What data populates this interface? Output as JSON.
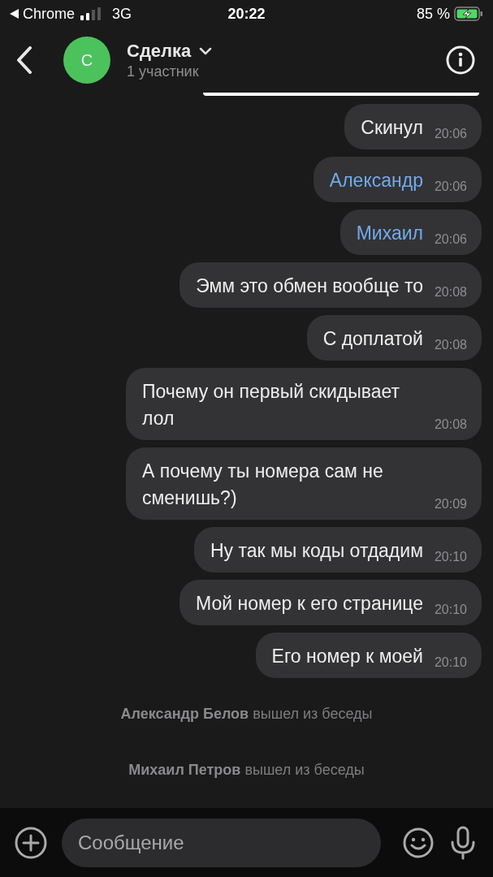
{
  "status_bar": {
    "back_app": "Chrome",
    "network": "3G",
    "time": "20:22",
    "battery": "85 %"
  },
  "header": {
    "avatar_letter": "С",
    "title": "Сделка",
    "subtitle": "1 участник"
  },
  "messages": [
    {
      "kind": "text",
      "text": "Скинул",
      "time": "20:06"
    },
    {
      "kind": "mention",
      "text": "Александр",
      "time": "20:06"
    },
    {
      "kind": "mention",
      "text": "Михаил",
      "time": "20:06"
    },
    {
      "kind": "text",
      "text": "Эмм это обмен вообще то",
      "time": "20:08"
    },
    {
      "kind": "text",
      "text": "С доплатой",
      "time": "20:08"
    },
    {
      "kind": "text",
      "text": "Почему он первый скидывает лол",
      "time": "20:08"
    },
    {
      "kind": "text",
      "text": "А почему ты номера сам не сменишь?)",
      "time": "20:09"
    },
    {
      "kind": "text",
      "text": "Ну так мы коды отдадим",
      "time": "20:10"
    },
    {
      "kind": "text",
      "text": "Мой номер к его странице",
      "time": "20:10"
    },
    {
      "kind": "text",
      "text": "Его номер к моей",
      "time": "20:10"
    }
  ],
  "events": [
    {
      "text": "**Александр Белов** вышел из беседы"
    },
    {
      "text": "**Михаил Петров** вышел из беседы"
    }
  ],
  "composer": {
    "placeholder": "Сообщение"
  }
}
